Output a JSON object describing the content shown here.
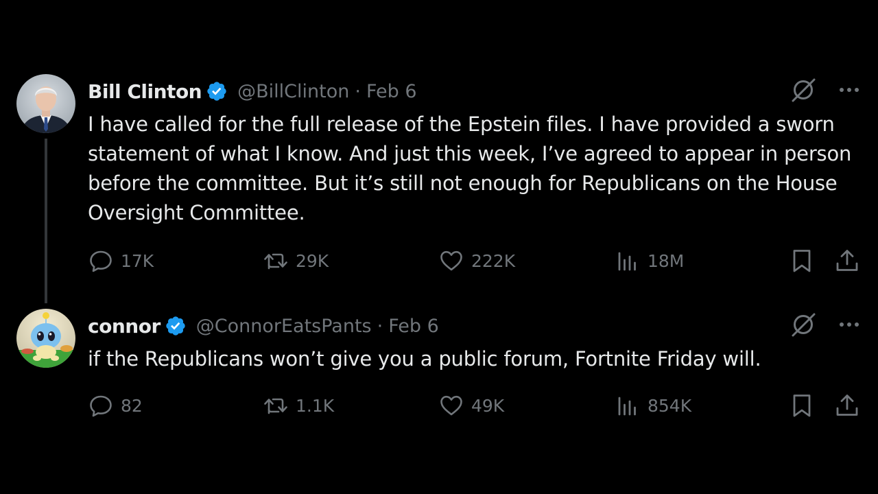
{
  "tweets": [
    {
      "name": "Bill Clinton",
      "handle": "@BillClinton",
      "separator": "·",
      "date": "Feb 6",
      "text": "I have called for the full release of the Epstein files. I have provided a sworn statement of what I know. And just this week, I’ve agreed to appear in person before the committee. But it’s still not enough for Republicans on the House Oversight Committee.",
      "stats": {
        "replies": "17K",
        "retweets": "29K",
        "likes": "222K",
        "views": "18M"
      }
    },
    {
      "name": "connor",
      "handle": "@ConnorEatsPants",
      "separator": "·",
      "date": "Feb 6",
      "text": "if the Republicans won’t give you a public forum, Fortnite Friday will.",
      "stats": {
        "replies": "82",
        "retweets": "1.1K",
        "likes": "49K",
        "views": "854K"
      }
    }
  ],
  "icons": [
    "verified-badge-icon",
    "grok-icon",
    "more-icon",
    "reply-icon",
    "retweet-icon",
    "like-icon",
    "views-icon",
    "bookmark-icon",
    "share-icon"
  ],
  "colors": {
    "background": "#000000",
    "primary_text": "#e7e9ea",
    "secondary_text": "#71767b",
    "verified_blue": "#1d9bf0",
    "thread_line": "#333639"
  }
}
